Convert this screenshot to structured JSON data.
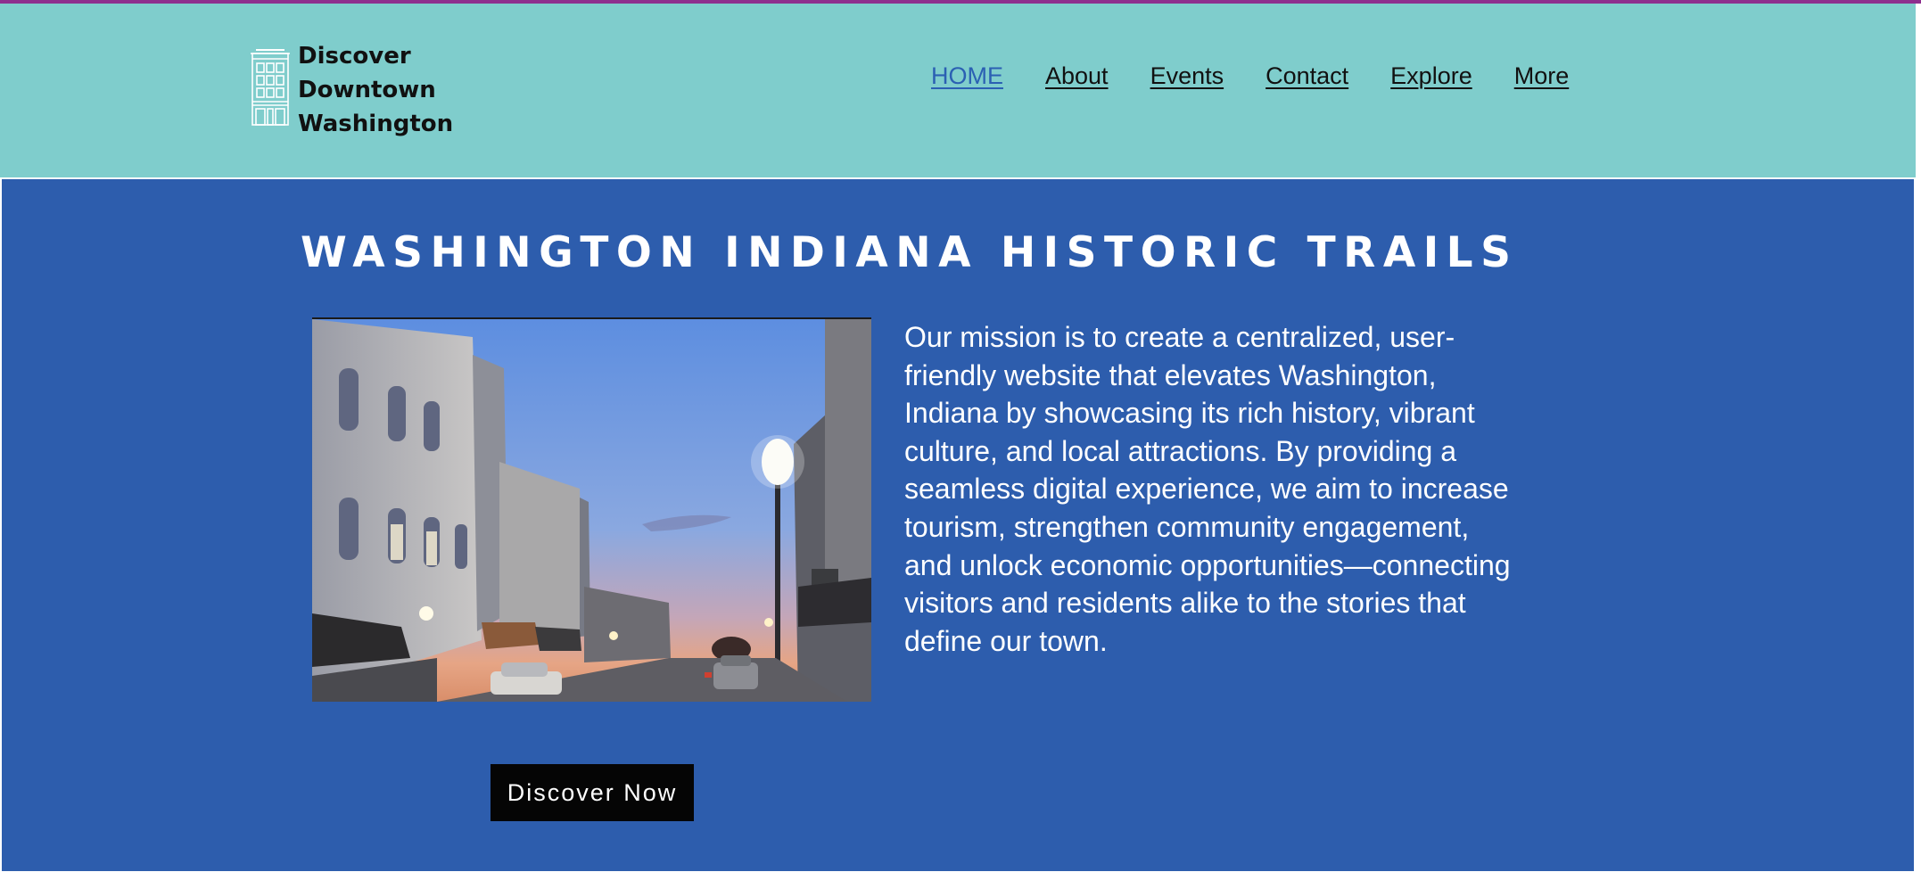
{
  "logo": {
    "icon": "building-icon",
    "line1": "Discover",
    "line2": "Downtown",
    "line3": "Washington"
  },
  "nav": {
    "items": [
      {
        "label": "HOME",
        "active": true
      },
      {
        "label": "About"
      },
      {
        "label": "Events"
      },
      {
        "label": "Contact"
      },
      {
        "label": "Explore"
      },
      {
        "label": "More"
      }
    ]
  },
  "hero": {
    "title": "WASHINGTON INDIANA HISTORIC TRAILS",
    "mission": "Our mission is to create a centralized, user-friendly website that elevates Washington, Indiana by showcasing its rich history, vibrant culture, and local attractions. By providing a seamless digital experience, we aim to increase tourism, strengthen community engagement, and unlock economic opportunities—connecting visitors and residents alike to the stories that define our town.",
    "cta_label": "Discover Now"
  },
  "colors": {
    "accent_top": "#8e2f8e",
    "header_bg": "#7fcdcc",
    "hero_bg": "#2d5dad",
    "nav_active": "#2b60b3",
    "button_bg": "#050505"
  }
}
